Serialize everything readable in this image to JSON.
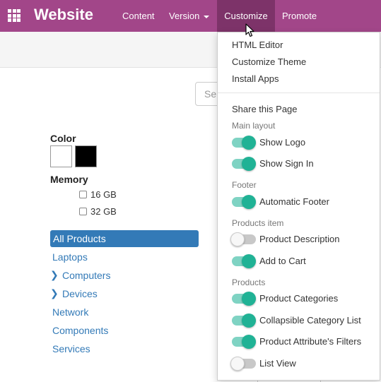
{
  "topbar": {
    "brand": "Website",
    "nav": {
      "content": "Content",
      "version": "Version",
      "customize": "Customize",
      "promote": "Promote"
    },
    "bar_color": "#a24689",
    "active_color": "#7d3369"
  },
  "search": {
    "placeholder": "Se"
  },
  "filters": {
    "color_title": "Color",
    "colors": [
      "#ffffff",
      "#000000"
    ],
    "memory_title": "Memory",
    "memory_options": [
      "16 GB",
      "32 GB"
    ]
  },
  "categories": {
    "active": "All Products",
    "laptops": "Laptops",
    "computers": "Computers",
    "devices": "Devices",
    "network": "Network",
    "components": "Components",
    "services": "Services"
  },
  "dropdown": {
    "html_editor": "HTML Editor",
    "customize_theme": "Customize Theme",
    "install_apps": "Install Apps",
    "share_page": "Share this Page",
    "main_layout_header": "Main layout",
    "show_logo": {
      "label": "Show Logo",
      "on": true
    },
    "show_sign_in": {
      "label": "Show Sign In",
      "on": true
    },
    "footer_header": "Footer",
    "automatic_footer": {
      "label": "Automatic Footer",
      "on": true
    },
    "products_item_header": "Products item",
    "product_description": {
      "label": "Product Description",
      "on": false
    },
    "add_to_cart": {
      "label": "Add to Cart",
      "on": true
    },
    "products_header": "Products",
    "product_categories": {
      "label": "Product Categories",
      "on": true
    },
    "collapsible_category_list": {
      "label": "Collapsible Category List",
      "on": true
    },
    "product_attribute_filters": {
      "label": "Product Attribute's Filters",
      "on": true
    },
    "list_view": {
      "label": "List View",
      "on": false
    },
    "toggle_on_color": "#20b295"
  }
}
